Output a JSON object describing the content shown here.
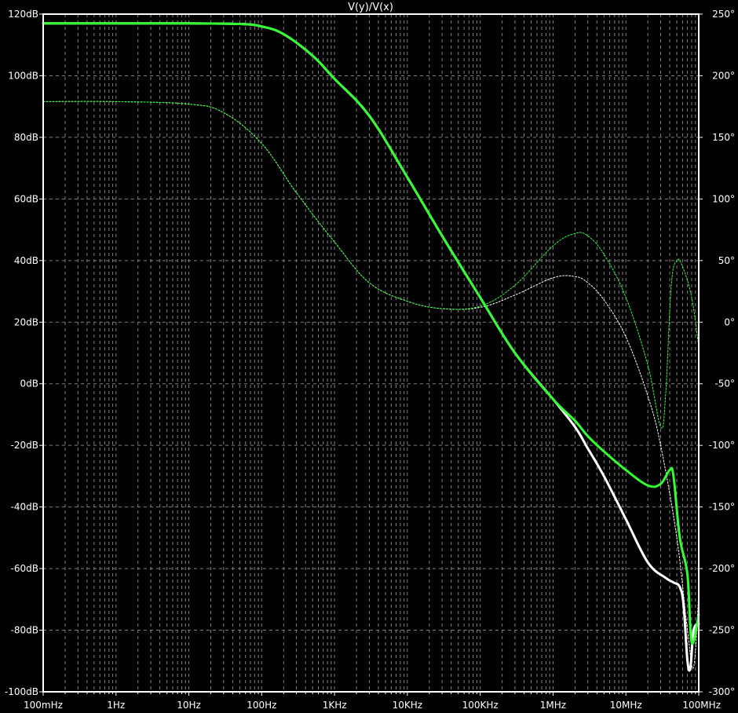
{
  "chart_data": {
    "type": "line",
    "title": "V(y)/V(x)",
    "x_scale": "log",
    "xlim": [
      0.1,
      100000000
    ],
    "x_ticks": [
      {
        "value": 0.1,
        "label": "100mHz"
      },
      {
        "value": 1,
        "label": "1Hz"
      },
      {
        "value": 10,
        "label": "10Hz"
      },
      {
        "value": 100,
        "label": "100Hz"
      },
      {
        "value": 1000,
        "label": "1KHz"
      },
      {
        "value": 10000,
        "label": "10KHz"
      },
      {
        "value": 100000,
        "label": "100KHz"
      },
      {
        "value": 1000000,
        "label": "1MHz"
      },
      {
        "value": 10000000,
        "label": "10MHz"
      },
      {
        "value": 100000000,
        "label": "100MHz"
      }
    ],
    "y_left": {
      "unit": "dB",
      "range": [
        -100,
        120
      ],
      "ticks": [
        {
          "value": 120,
          "label": "120dB"
        },
        {
          "value": 100,
          "label": "100dB"
        },
        {
          "value": 80,
          "label": "80dB"
        },
        {
          "value": 60,
          "label": "60dB"
        },
        {
          "value": 40,
          "label": "40dB"
        },
        {
          "value": 20,
          "label": "20dB"
        },
        {
          "value": 0,
          "label": "0dB"
        },
        {
          "value": -20,
          "label": "-20dB"
        },
        {
          "value": -40,
          "label": "-40dB"
        },
        {
          "value": -60,
          "label": "-60dB"
        },
        {
          "value": -80,
          "label": "-80dB"
        },
        {
          "value": -100,
          "label": "-100dB"
        }
      ]
    },
    "y_right": {
      "unit": "°",
      "range": [
        -300,
        250
      ],
      "ticks": [
        {
          "value": 250,
          "label": "250°"
        },
        {
          "value": 200,
          "label": "200°"
        },
        {
          "value": 150,
          "label": "150°"
        },
        {
          "value": 100,
          "label": "100°"
        },
        {
          "value": 50,
          "label": "50°"
        },
        {
          "value": 0,
          "label": "0°"
        },
        {
          "value": -50,
          "label": "-50°"
        },
        {
          "value": -100,
          "label": "-100°"
        },
        {
          "value": -150,
          "label": "-150°"
        },
        {
          "value": -200,
          "label": "-200°"
        },
        {
          "value": -250,
          "label": "-250°"
        },
        {
          "value": -300,
          "label": "-300°"
        }
      ]
    },
    "grid": true,
    "series": [
      {
        "axis": "left",
        "style": "solid",
        "color": "#ffffff",
        "x": [
          0.1,
          1,
          10,
          50,
          100,
          200,
          500,
          1000,
          3000,
          10000,
          30000,
          100000,
          300000,
          1000000,
          2000000,
          3000000,
          5000000,
          10000000,
          20000000,
          35000000,
          45000000,
          55000000,
          62000000,
          70000000,
          77000000,
          85000000,
          100000000
        ],
        "y": [
          117,
          117,
          117,
          116.8,
          116,
          113.5,
          106.5,
          99,
          87,
          67,
          48,
          28,
          10,
          -5,
          -14,
          -21,
          -30,
          -44,
          -58,
          -63,
          -64.5,
          -66,
          -72,
          -90,
          -92,
          -80,
          -78
        ]
      },
      {
        "axis": "left",
        "style": "solid",
        "color": "#33ff33",
        "x": [
          0.1,
          1,
          10,
          50,
          100,
          200,
          500,
          1000,
          3000,
          10000,
          30000,
          100000,
          300000,
          1000000,
          2000000,
          3000000,
          5000000,
          10000000,
          20000000,
          30000000,
          40000000,
          45000000,
          55000000,
          70000000,
          80000000,
          100000000
        ],
        "y": [
          117,
          117,
          117,
          116.8,
          116,
          113.5,
          106.5,
          99,
          87,
          67,
          48,
          28,
          10,
          -5,
          -12,
          -17,
          -22,
          -28,
          -33,
          -32.5,
          -28,
          -30,
          -50,
          -62,
          -84,
          -75
        ]
      },
      {
        "axis": "right",
        "style": "dashed",
        "color": "#ffffff",
        "x": [
          0.1,
          1,
          10,
          30,
          100,
          300,
          1000,
          3000,
          10000,
          30000,
          100000,
          300000,
          1000000,
          2000000,
          3000000,
          5000000,
          10000000,
          20000000,
          30000000,
          50000000,
          70000000,
          85000000,
          100000000
        ],
        "y": [
          179,
          179,
          177,
          170,
          145,
          105,
          65,
          32,
          17,
          11,
          12,
          22,
          36,
          37,
          32,
          18,
          -12,
          -60,
          -100,
          -175,
          -250,
          -280,
          -220
        ]
      },
      {
        "axis": "right",
        "style": "dashed",
        "color": "#33ff33",
        "x": [
          0.1,
          1,
          10,
          30,
          100,
          300,
          1000,
          3000,
          10000,
          30000,
          100000,
          300000,
          1000000,
          2000000,
          3000000,
          5000000,
          10000000,
          20000000,
          30000000,
          35000000,
          42000000,
          50000000,
          60000000,
          80000000,
          100000000
        ],
        "y": [
          179,
          179,
          177,
          170,
          145,
          105,
          65,
          32,
          17,
          11,
          13,
          30,
          62,
          72,
          70,
          55,
          20,
          -35,
          -85,
          -60,
          30,
          50,
          45,
          20,
          -20
        ]
      }
    ]
  }
}
